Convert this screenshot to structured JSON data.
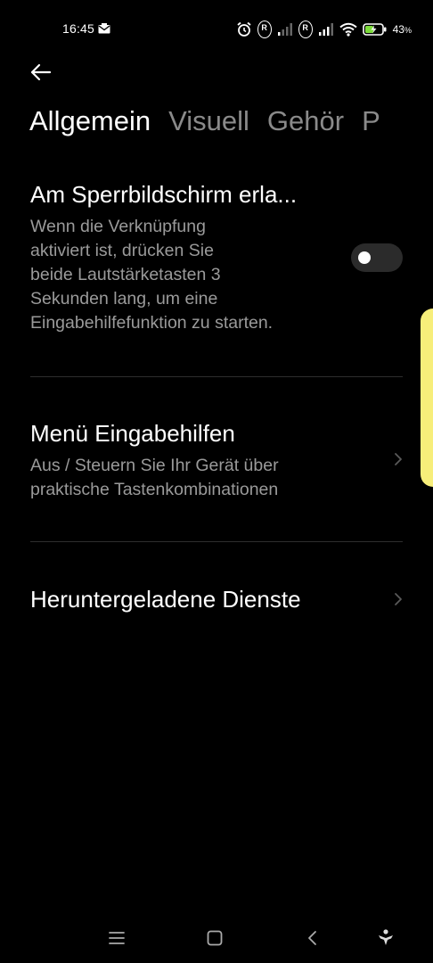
{
  "status_bar": {
    "time": "16:45",
    "battery_percent": "43",
    "battery_unit": "%"
  },
  "tabs": [
    {
      "label": "Allgemein",
      "active": true
    },
    {
      "label": "Visuell",
      "active": false
    },
    {
      "label": "Gehör",
      "active": false
    },
    {
      "label": "P",
      "active": false
    }
  ],
  "settings": {
    "lock_screen": {
      "title": "Am Sperrbildschirm erla...",
      "description_lines": [
        "Wenn die Verknüpfung",
        "aktiviert ist, drücken Sie",
        "beide Lautstärketasten 3",
        "Sekunden lang, um eine",
        "Eingabehilfefunktion zu starten."
      ],
      "toggle_on": false
    },
    "accessibility_menu": {
      "title": "Menü Eingabehilfen",
      "description_lines": [
        "Aus / Steuern Sie Ihr Gerät über",
        "praktische Tastenkombinationen"
      ]
    },
    "downloaded_services": {
      "title": "Heruntergeladene Dienste"
    }
  },
  "colors": {
    "background": "#000000",
    "primary_text": "#ffffff",
    "secondary_text": "#9a9a9a",
    "inactive_tab": "#8a8a8a",
    "toggle_track": "#2b2b2b",
    "divider": "#2e2e2e",
    "edge_handle": "#f7ee7a",
    "battery_charging": "#7cdc3a"
  },
  "icons": {
    "back": "arrow-left-icon",
    "chevron": "chevron-right-icon",
    "nav_menu": "hamburger-icon",
    "nav_home": "square-icon",
    "nav_back": "chevron-left-icon",
    "nav_assist": "accessibility-person-icon"
  }
}
